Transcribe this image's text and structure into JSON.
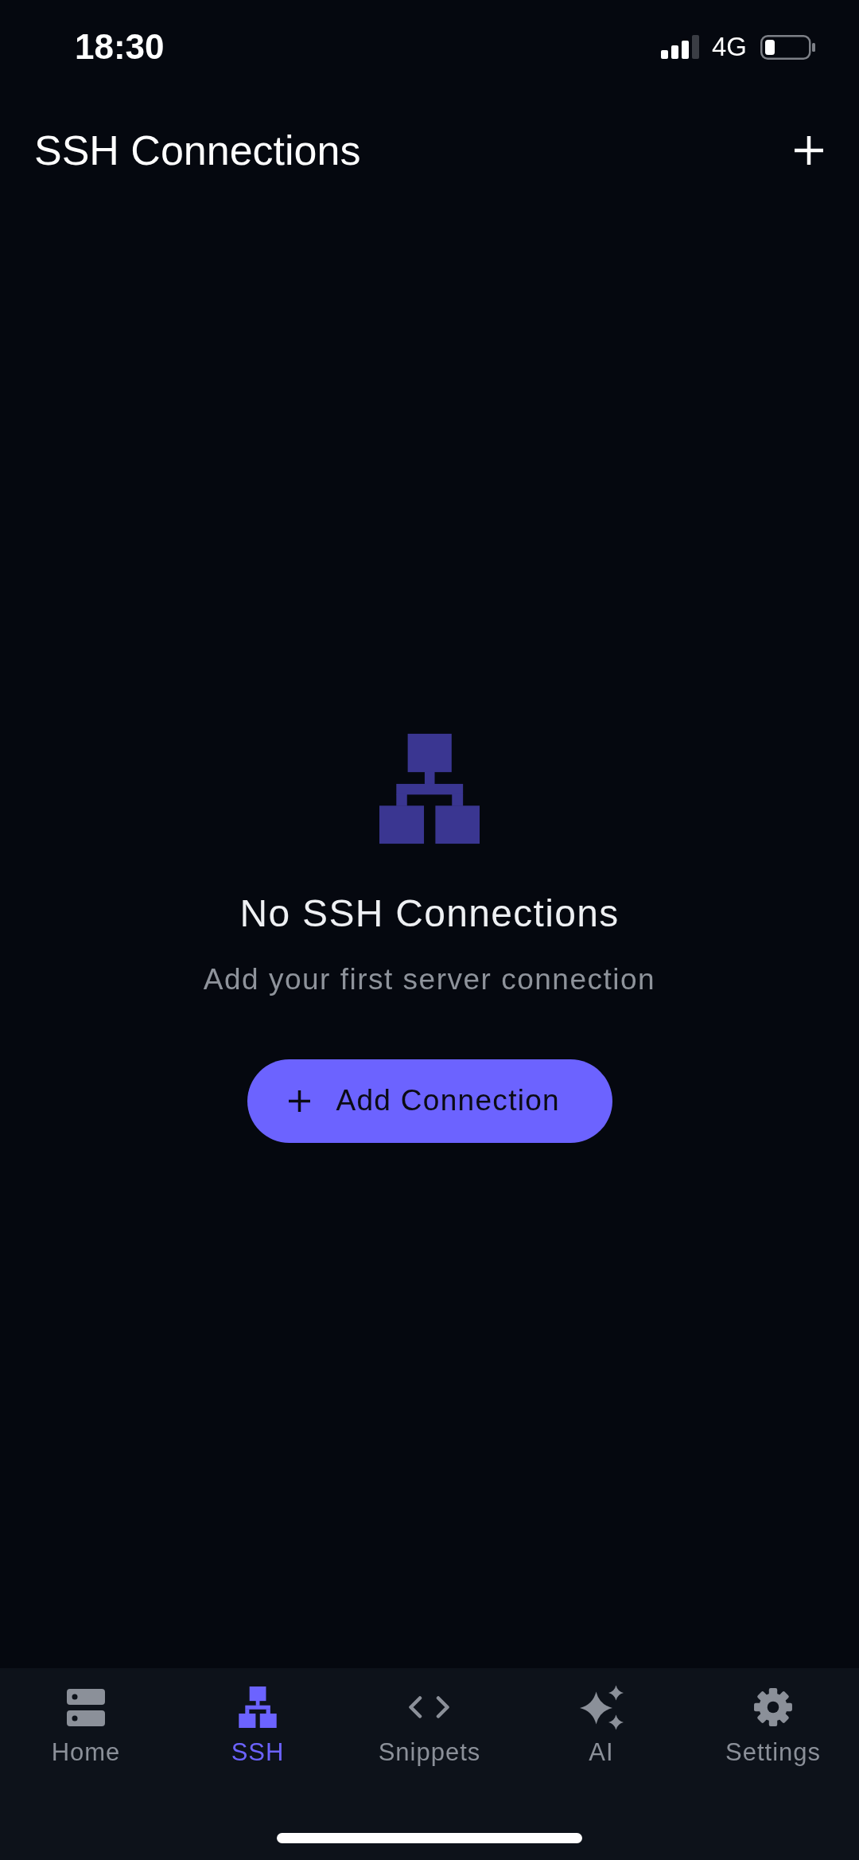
{
  "status_bar": {
    "time": "18:30",
    "network": "4G"
  },
  "header": {
    "title": "SSH Connections"
  },
  "empty_state": {
    "title": "No SSH Connections",
    "subtitle": "Add your first server connection",
    "button": {
      "label": "Add Connection"
    }
  },
  "tab_bar": [
    {
      "label": "Home",
      "kind": "server",
      "selected": false
    },
    {
      "label": "SSH",
      "kind": "sitemap",
      "selected": true
    },
    {
      "label": "Snippets",
      "kind": "code",
      "selected": false
    },
    {
      "label": "AI",
      "kind": "sparkles",
      "selected": false
    },
    {
      "label": "Settings",
      "kind": "gear",
      "selected": false
    }
  ]
}
